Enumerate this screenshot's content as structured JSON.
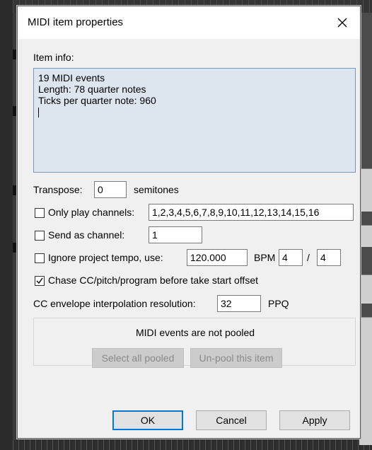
{
  "dialog": {
    "title": "MIDI item properties",
    "item_info_label": "Item info:",
    "item_info_text": "19 MIDI events\nLength:  78 quarter notes\nTicks per quarter note: 960"
  },
  "transpose": {
    "label": "Transpose:",
    "value": "0",
    "unit": "semitones"
  },
  "only_play_channels": {
    "label": "Only play channels:",
    "checked": false,
    "value": "1,2,3,4,5,6,7,8,9,10,11,12,13,14,15,16"
  },
  "send_as_channel": {
    "label": "Send as channel:",
    "checked": false,
    "value": "1"
  },
  "ignore_tempo": {
    "label": "Ignore project tempo, use:",
    "checked": false,
    "bpm_value": "120.000",
    "bpm_label": "BPM",
    "time_sig_num": "4",
    "time_sig_sep": "/",
    "time_sig_den": "4"
  },
  "chase_cc": {
    "label": "Chase CC/pitch/program before take start offset",
    "checked": true
  },
  "cc_interp": {
    "label": "CC envelope interpolation resolution:",
    "value": "32",
    "unit": "PPQ"
  },
  "pooling": {
    "status": "MIDI events are not pooled",
    "select_all_pooled": "Select all pooled",
    "unpool": "Un-pool this item"
  },
  "buttons": {
    "ok": "OK",
    "cancel": "Cancel",
    "apply": "Apply"
  },
  "colors": {
    "accent": "#0078d7",
    "info_box_bg": "#dde6ee"
  }
}
